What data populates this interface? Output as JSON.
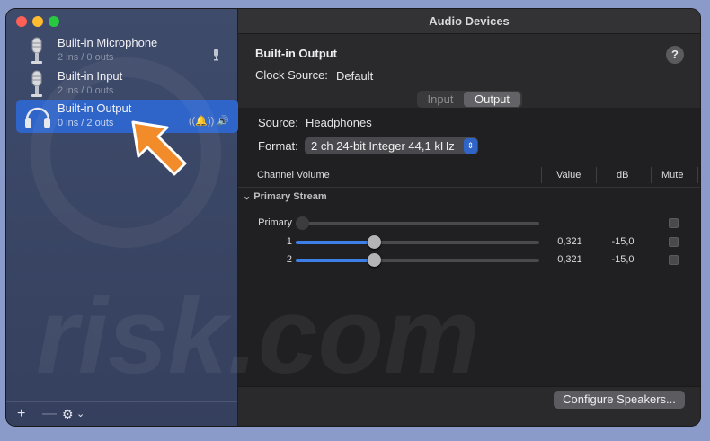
{
  "window": {
    "title": "Audio Devices"
  },
  "sidebar": {
    "devices": [
      {
        "name": "Built-in Microphone",
        "sub": "2 ins / 0 outs",
        "icon": "microphone-icon",
        "right_icon": "microphone-small-icon"
      },
      {
        "name": "Built-in Input",
        "sub": "2 ins / 0 outs",
        "icon": "microphone-icon"
      },
      {
        "name": "Built-in Output",
        "sub": "0 ins / 2 outs",
        "icon": "headphones-icon",
        "right_icon": "speaker-icon",
        "selected": true
      }
    ],
    "footer": {
      "add": "+",
      "remove": "—",
      "gear": "⚙",
      "chevron": "⌄"
    }
  },
  "device": {
    "title": "Built-in Output",
    "clock_label": "Clock Source:",
    "clock_value": "Default",
    "help": "?"
  },
  "tabs": {
    "input": "Input",
    "output": "Output",
    "selected": "Output"
  },
  "source": {
    "label": "Source:",
    "value": "Headphones"
  },
  "format": {
    "label": "Format:",
    "value": "2 ch 24-bit Integer 44,1 kHz"
  },
  "table": {
    "headers": {
      "channel_volume": "Channel Volume",
      "value": "Value",
      "db": "dB",
      "mute": "Mute"
    },
    "stream": "Primary Stream",
    "rows": [
      {
        "label": "Primary",
        "value": "",
        "db": "",
        "level": 0,
        "enabled": false
      },
      {
        "label": "1",
        "value": "0,321",
        "db": "-15,0",
        "level": 0.321,
        "enabled": true
      },
      {
        "label": "2",
        "value": "0,321",
        "db": "-15,0",
        "level": 0.321,
        "enabled": true
      }
    ]
  },
  "buttons": {
    "configure": "Configure Speakers..."
  },
  "colors": {
    "accent": "#2f64c9",
    "arrow": "#f28c2a"
  },
  "watermark": "risk.com"
}
